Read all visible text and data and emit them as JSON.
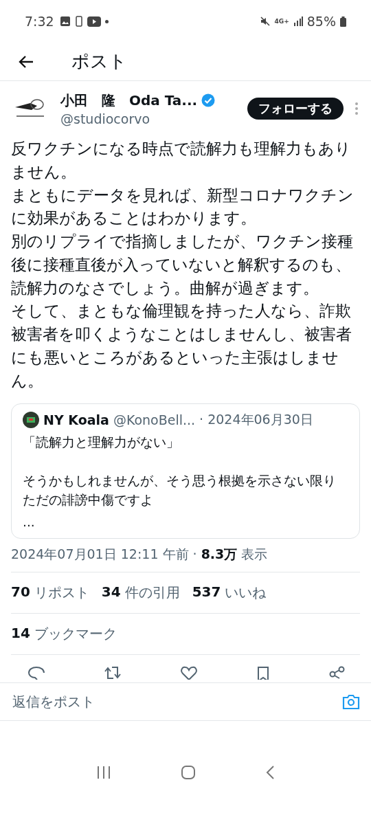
{
  "status_bar": {
    "time": "7:32",
    "network": "4G+",
    "battery": "85%"
  },
  "header": {
    "title": "ポスト"
  },
  "author": {
    "name": "小田　隆　Oda Ta...",
    "verified": true,
    "handle": "@studiocorvo",
    "follow_label": "フォローする"
  },
  "post": {
    "paragraphs": [
      "反ワクチンになる時点で読解力も理解力もありません。",
      "まともにデータを見れば、新型コロナワクチンに効果があることはわかります。",
      "別のリプライで指摘しましたが、ワクチン接種後に接種直後が入っていないと解釈するのも、読解力のなさでしょう。曲解が過ぎます。",
      "そして、まともな倫理観を持った人なら、詐欺被害者を叩くようなことはしませんし、被害者にも悪いところがあるといった主張はしません。"
    ]
  },
  "quote": {
    "name": "NY Koala",
    "handle": "@KonoBell...",
    "date": "· 2024年06月30日",
    "paragraphs": [
      "「読解力と理解力がない」",
      "そうかもしれませんが、そう思う根拠を示さない限りただの誹謗中傷ですよ",
      "..."
    ]
  },
  "meta": {
    "timestamp": "2024年07月01日 12:11 午前 ·",
    "views_count": "8.3万",
    "views_label": "表示"
  },
  "stats": [
    {
      "count": "70",
      "label": "リポスト"
    },
    {
      "count": "34",
      "label": "件の引用"
    },
    {
      "count": "537",
      "label": "いいね"
    }
  ],
  "bookmarks": {
    "count": "14",
    "label": "ブックマーク"
  },
  "reply": {
    "placeholder": "返信をポスト"
  }
}
